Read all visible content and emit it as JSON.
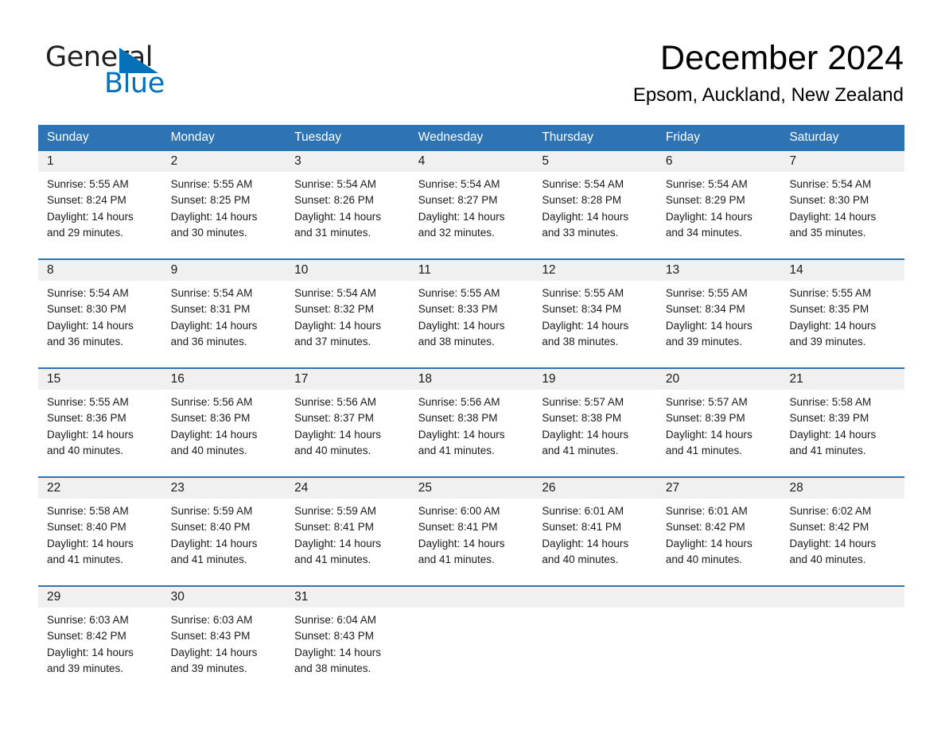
{
  "brand": {
    "name_part1": "General",
    "name_part2": "Blue",
    "triangle_icon": "triangle-icon",
    "accent_color": "#0571b8"
  },
  "header": {
    "month_title": "December 2024",
    "location": "Epsom, Auckland, New Zealand"
  },
  "theme": {
    "header_blue": "#2e74b5",
    "row_divider_blue": "#2e74b5",
    "daynum_band_gray": "#f0f0f0",
    "text_color": "#1a1a1a"
  },
  "calendar": {
    "weekdays": [
      "Sunday",
      "Monday",
      "Tuesday",
      "Wednesday",
      "Thursday",
      "Friday",
      "Saturday"
    ],
    "weeks": [
      {
        "days": [
          {
            "date": "1",
            "sunrise": "Sunrise: 5:55 AM",
            "sunset": "Sunset: 8:24 PM",
            "daylight_line1": "Daylight: 14 hours",
            "daylight_line2": "and 29 minutes."
          },
          {
            "date": "2",
            "sunrise": "Sunrise: 5:55 AM",
            "sunset": "Sunset: 8:25 PM",
            "daylight_line1": "Daylight: 14 hours",
            "daylight_line2": "and 30 minutes."
          },
          {
            "date": "3",
            "sunrise": "Sunrise: 5:54 AM",
            "sunset": "Sunset: 8:26 PM",
            "daylight_line1": "Daylight: 14 hours",
            "daylight_line2": "and 31 minutes."
          },
          {
            "date": "4",
            "sunrise": "Sunrise: 5:54 AM",
            "sunset": "Sunset: 8:27 PM",
            "daylight_line1": "Daylight: 14 hours",
            "daylight_line2": "and 32 minutes."
          },
          {
            "date": "5",
            "sunrise": "Sunrise: 5:54 AM",
            "sunset": "Sunset: 8:28 PM",
            "daylight_line1": "Daylight: 14 hours",
            "daylight_line2": "and 33 minutes."
          },
          {
            "date": "6",
            "sunrise": "Sunrise: 5:54 AM",
            "sunset": "Sunset: 8:29 PM",
            "daylight_line1": "Daylight: 14 hours",
            "daylight_line2": "and 34 minutes."
          },
          {
            "date": "7",
            "sunrise": "Sunrise: 5:54 AM",
            "sunset": "Sunset: 8:30 PM",
            "daylight_line1": "Daylight: 14 hours",
            "daylight_line2": "and 35 minutes."
          }
        ]
      },
      {
        "days": [
          {
            "date": "8",
            "sunrise": "Sunrise: 5:54 AM",
            "sunset": "Sunset: 8:30 PM",
            "daylight_line1": "Daylight: 14 hours",
            "daylight_line2": "and 36 minutes."
          },
          {
            "date": "9",
            "sunrise": "Sunrise: 5:54 AM",
            "sunset": "Sunset: 8:31 PM",
            "daylight_line1": "Daylight: 14 hours",
            "daylight_line2": "and 36 minutes."
          },
          {
            "date": "10",
            "sunrise": "Sunrise: 5:54 AM",
            "sunset": "Sunset: 8:32 PM",
            "daylight_line1": "Daylight: 14 hours",
            "daylight_line2": "and 37 minutes."
          },
          {
            "date": "11",
            "sunrise": "Sunrise: 5:55 AM",
            "sunset": "Sunset: 8:33 PM",
            "daylight_line1": "Daylight: 14 hours",
            "daylight_line2": "and 38 minutes."
          },
          {
            "date": "12",
            "sunrise": "Sunrise: 5:55 AM",
            "sunset": "Sunset: 8:34 PM",
            "daylight_line1": "Daylight: 14 hours",
            "daylight_line2": "and 38 minutes."
          },
          {
            "date": "13",
            "sunrise": "Sunrise: 5:55 AM",
            "sunset": "Sunset: 8:34 PM",
            "daylight_line1": "Daylight: 14 hours",
            "daylight_line2": "and 39 minutes."
          },
          {
            "date": "14",
            "sunrise": "Sunrise: 5:55 AM",
            "sunset": "Sunset: 8:35 PM",
            "daylight_line1": "Daylight: 14 hours",
            "daylight_line2": "and 39 minutes."
          }
        ]
      },
      {
        "days": [
          {
            "date": "15",
            "sunrise": "Sunrise: 5:55 AM",
            "sunset": "Sunset: 8:36 PM",
            "daylight_line1": "Daylight: 14 hours",
            "daylight_line2": "and 40 minutes."
          },
          {
            "date": "16",
            "sunrise": "Sunrise: 5:56 AM",
            "sunset": "Sunset: 8:36 PM",
            "daylight_line1": "Daylight: 14 hours",
            "daylight_line2": "and 40 minutes."
          },
          {
            "date": "17",
            "sunrise": "Sunrise: 5:56 AM",
            "sunset": "Sunset: 8:37 PM",
            "daylight_line1": "Daylight: 14 hours",
            "daylight_line2": "and 40 minutes."
          },
          {
            "date": "18",
            "sunrise": "Sunrise: 5:56 AM",
            "sunset": "Sunset: 8:38 PM",
            "daylight_line1": "Daylight: 14 hours",
            "daylight_line2": "and 41 minutes."
          },
          {
            "date": "19",
            "sunrise": "Sunrise: 5:57 AM",
            "sunset": "Sunset: 8:38 PM",
            "daylight_line1": "Daylight: 14 hours",
            "daylight_line2": "and 41 minutes."
          },
          {
            "date": "20",
            "sunrise": "Sunrise: 5:57 AM",
            "sunset": "Sunset: 8:39 PM",
            "daylight_line1": "Daylight: 14 hours",
            "daylight_line2": "and 41 minutes."
          },
          {
            "date": "21",
            "sunrise": "Sunrise: 5:58 AM",
            "sunset": "Sunset: 8:39 PM",
            "daylight_line1": "Daylight: 14 hours",
            "daylight_line2": "and 41 minutes."
          }
        ]
      },
      {
        "days": [
          {
            "date": "22",
            "sunrise": "Sunrise: 5:58 AM",
            "sunset": "Sunset: 8:40 PM",
            "daylight_line1": "Daylight: 14 hours",
            "daylight_line2": "and 41 minutes."
          },
          {
            "date": "23",
            "sunrise": "Sunrise: 5:59 AM",
            "sunset": "Sunset: 8:40 PM",
            "daylight_line1": "Daylight: 14 hours",
            "daylight_line2": "and 41 minutes."
          },
          {
            "date": "24",
            "sunrise": "Sunrise: 5:59 AM",
            "sunset": "Sunset: 8:41 PM",
            "daylight_line1": "Daylight: 14 hours",
            "daylight_line2": "and 41 minutes."
          },
          {
            "date": "25",
            "sunrise": "Sunrise: 6:00 AM",
            "sunset": "Sunset: 8:41 PM",
            "daylight_line1": "Daylight: 14 hours",
            "daylight_line2": "and 41 minutes."
          },
          {
            "date": "26",
            "sunrise": "Sunrise: 6:01 AM",
            "sunset": "Sunset: 8:41 PM",
            "daylight_line1": "Daylight: 14 hours",
            "daylight_line2": "and 40 minutes."
          },
          {
            "date": "27",
            "sunrise": "Sunrise: 6:01 AM",
            "sunset": "Sunset: 8:42 PM",
            "daylight_line1": "Daylight: 14 hours",
            "daylight_line2": "and 40 minutes."
          },
          {
            "date": "28",
            "sunrise": "Sunrise: 6:02 AM",
            "sunset": "Sunset: 8:42 PM",
            "daylight_line1": "Daylight: 14 hours",
            "daylight_line2": "and 40 minutes."
          }
        ]
      },
      {
        "days": [
          {
            "date": "29",
            "sunrise": "Sunrise: 6:03 AM",
            "sunset": "Sunset: 8:42 PM",
            "daylight_line1": "Daylight: 14 hours",
            "daylight_line2": "and 39 minutes."
          },
          {
            "date": "30",
            "sunrise": "Sunrise: 6:03 AM",
            "sunset": "Sunset: 8:43 PM",
            "daylight_line1": "Daylight: 14 hours",
            "daylight_line2": "and 39 minutes."
          },
          {
            "date": "31",
            "sunrise": "Sunrise: 6:04 AM",
            "sunset": "Sunset: 8:43 PM",
            "daylight_line1": "Daylight: 14 hours",
            "daylight_line2": "and 38 minutes."
          },
          {
            "date": "",
            "sunrise": "",
            "sunset": "",
            "daylight_line1": "",
            "daylight_line2": ""
          },
          {
            "date": "",
            "sunrise": "",
            "sunset": "",
            "daylight_line1": "",
            "daylight_line2": ""
          },
          {
            "date": "",
            "sunrise": "",
            "sunset": "",
            "daylight_line1": "",
            "daylight_line2": ""
          },
          {
            "date": "",
            "sunrise": "",
            "sunset": "",
            "daylight_line1": "",
            "daylight_line2": ""
          }
        ]
      }
    ]
  }
}
